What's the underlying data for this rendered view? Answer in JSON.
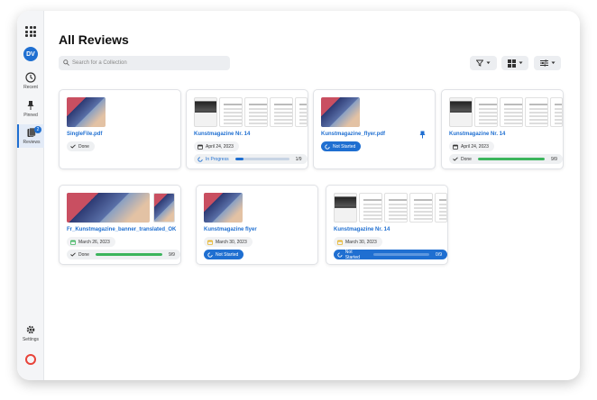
{
  "sidebar": {
    "avatar": "DV",
    "items": [
      {
        "label": "Recent",
        "icon": "clock-icon"
      },
      {
        "label": "Pinned",
        "icon": "pin-icon"
      },
      {
        "label": "Reviews",
        "icon": "reviews-icon",
        "badge": "2",
        "active": true
      }
    ],
    "settings_label": "Settings"
  },
  "header": {
    "title": "All Reviews",
    "search_placeholder": "Search for a Collection"
  },
  "cards": [
    {
      "title": "SingleFile.pdf",
      "status": "Done"
    },
    {
      "title": "Kunstmagazine Nr. 14",
      "date": "April 24, 2023",
      "status": "In Progress",
      "progress": 0.15,
      "count": "1/9"
    },
    {
      "title": "Kunstmagazine_flyer.pdf",
      "status": "Not Started",
      "pinned": true
    },
    {
      "title": "Kunstmagazine Nr. 14",
      "date": "April 24, 2023",
      "status": "Done",
      "progress": 1.0,
      "count": "9/9"
    },
    {
      "title": "Fr_Kunstmagazine_banner_translated_OK",
      "date": "March 26, 2023",
      "status": "Done",
      "progress": 1.0,
      "count": "9/9"
    },
    {
      "title": "Kunstmagazine flyer",
      "date": "March 30, 2023",
      "status": "Not Started"
    },
    {
      "title": "Kunstmagazine Nr. 14",
      "date": "March 30, 2023",
      "status": "Not Started",
      "progress": 0,
      "count": "0/9"
    }
  ],
  "colors": {
    "accent": "#1f6fd1",
    "done": "#3cb55c",
    "date_icon_yellow": "#e6b325",
    "date_icon_green": "#3cb55c"
  }
}
